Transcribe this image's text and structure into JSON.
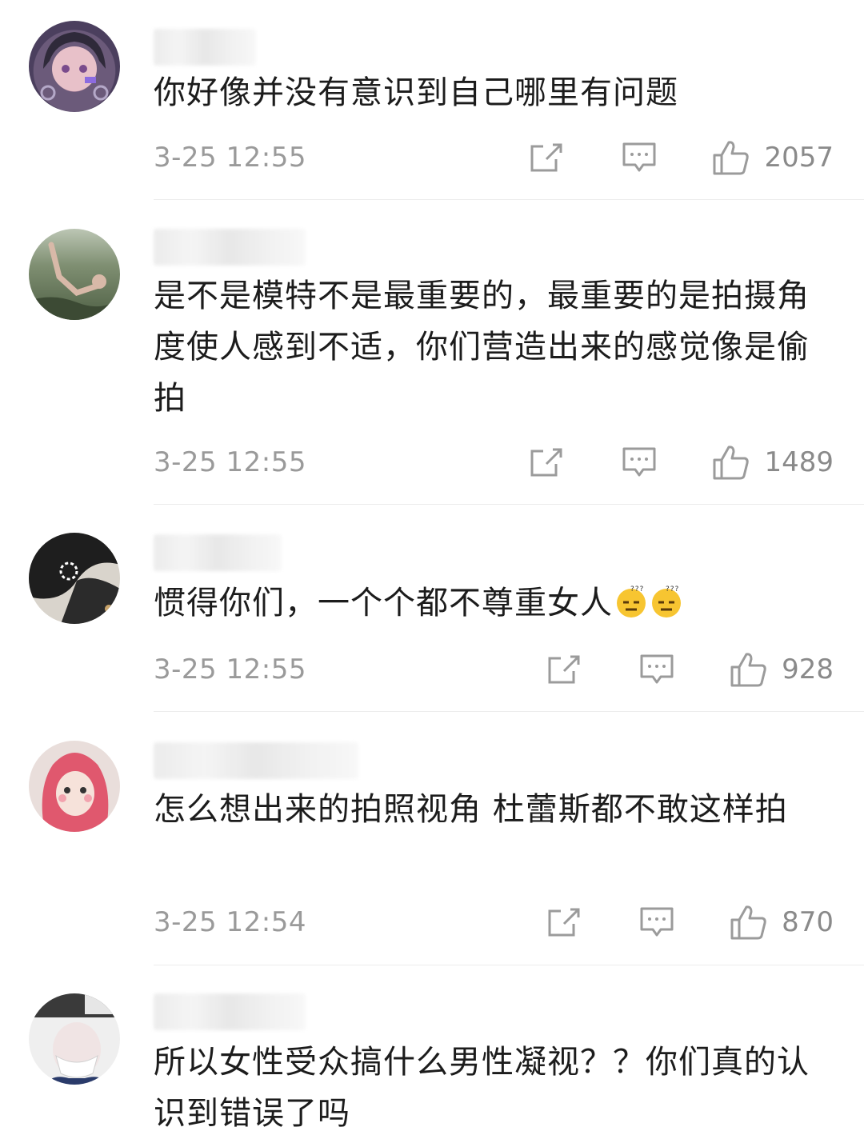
{
  "comments": [
    {
      "text": "你好像并没有意识到自己哪里有问题",
      "time": "3-25 12:55",
      "likes": "2057"
    },
    {
      "text": "是不是模特不是最重要的，最重要的是拍摄角度使人感到不适，你们营造出来的感觉像是偷拍",
      "time": "3-25 12:55",
      "likes": "1489"
    },
    {
      "text": "惯得你们，一个个都不尊重女人",
      "time": "3-25 12:55",
      "likes": "928",
      "emojis": [
        "dizzy-face-emoji",
        "dizzy-face-emoji"
      ]
    },
    {
      "text": "怎么想出来的拍照视角 杜蕾斯都不敢这样拍",
      "time": "3-25 12:54",
      "likes": "870"
    },
    {
      "text": "所以女性受众搞什么男性凝视？？你们真的认识到错误了吗"
    }
  ],
  "icons": {
    "share": "share-icon",
    "reply": "comment-icon",
    "like": "thumbs-up-icon"
  },
  "colors": {
    "meta_text": "#9a9a9a",
    "icon": "#9b9b9b",
    "divider": "#ececec"
  }
}
